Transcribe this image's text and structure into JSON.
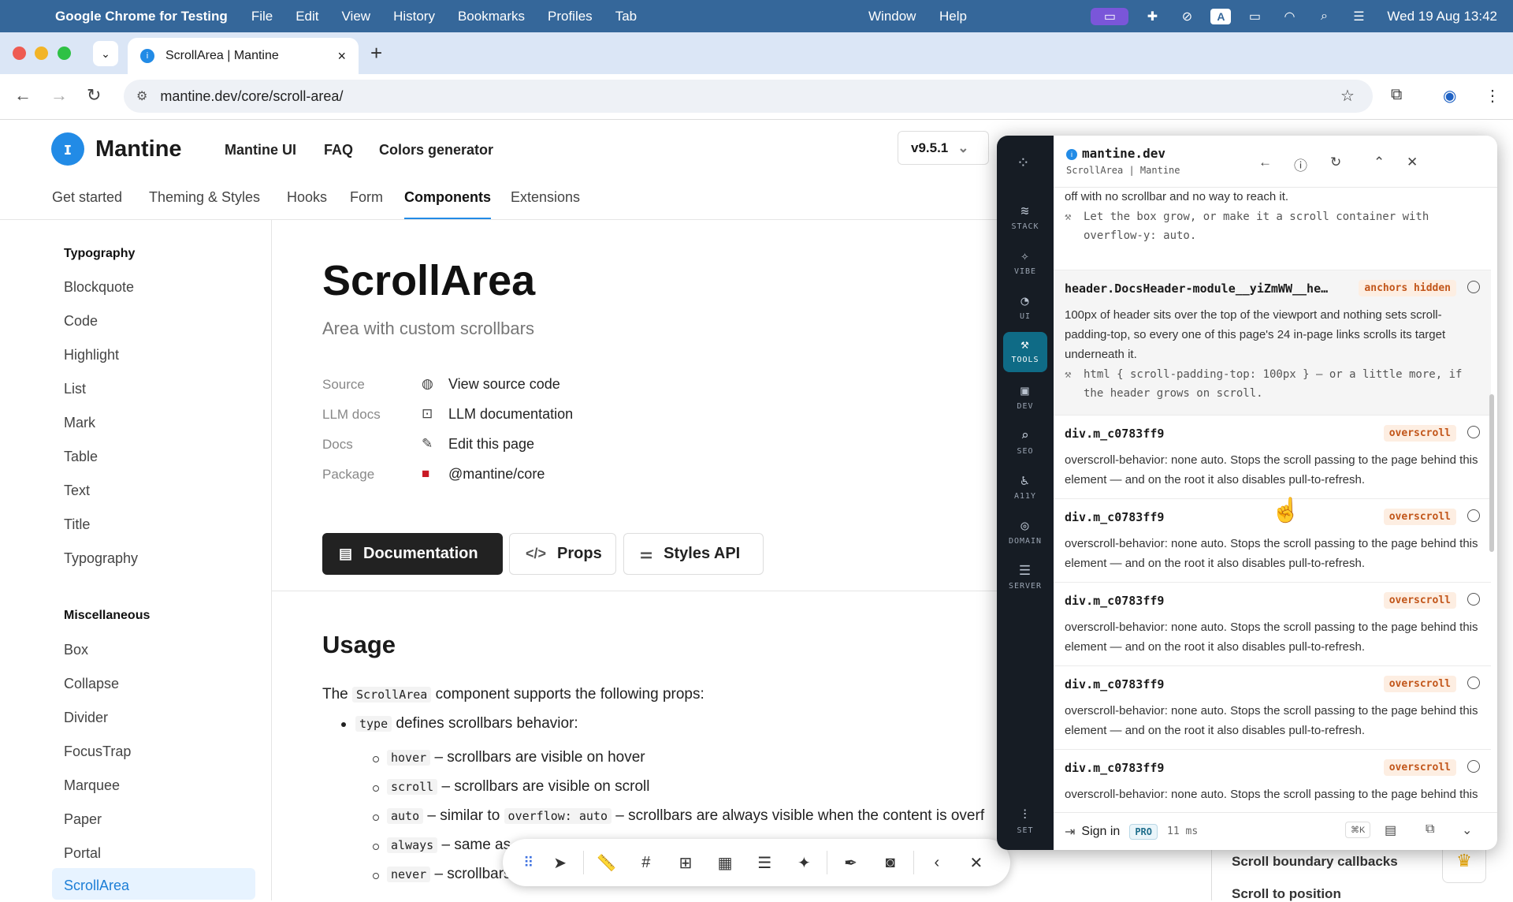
{
  "menubar": {
    "app_name": "Google Chrome for Testing",
    "items": [
      "File",
      "Edit",
      "View",
      "History",
      "Bookmarks",
      "Profiles",
      "Tab"
    ],
    "window": "Window",
    "help": "Help",
    "tray_a": "A",
    "clock": "Wed 19 Aug  13:42"
  },
  "browser": {
    "tab_title": "ScrollArea | Mantine",
    "url": "mantine.dev/core/scroll-area/"
  },
  "site": {
    "logo": "Mantine",
    "header_links": [
      "Mantine UI",
      "FAQ",
      "Colors generator"
    ],
    "version": "v9.5.1",
    "sections": [
      "Get started",
      "Theming & Styles",
      "Hooks",
      "Form",
      "Components",
      "Extensions"
    ],
    "active_section": "Components"
  },
  "sidebar": {
    "group1": "Typography",
    "group1_items": [
      "Blockquote",
      "Code",
      "Highlight",
      "List",
      "Mark",
      "Table",
      "Text",
      "Title",
      "Typography"
    ],
    "group2": "Miscellaneous",
    "group2_items": [
      "Box",
      "Collapse",
      "Divider",
      "FocusTrap",
      "Marquee",
      "Paper",
      "Portal",
      "ScrollArea"
    ],
    "selected": "ScrollArea"
  },
  "page": {
    "title": "ScrollArea",
    "subtitle": "Area with custom scrollbars",
    "meta": [
      {
        "key": "Source",
        "value": "View source code"
      },
      {
        "key": "LLM docs",
        "value": "LLM documentation"
      },
      {
        "key": "Docs",
        "value": "Edit this page"
      },
      {
        "key": "Package",
        "value": "@mantine/core"
      }
    ],
    "tabs": [
      "Documentation",
      "Props",
      "Styles API"
    ],
    "usage_heading": "Usage",
    "intro_pre": "The",
    "intro_code": "ScrollArea",
    "intro_post": "component supports the following props:",
    "type_code": "type",
    "type_text": "defines scrollbars behavior:",
    "list": [
      {
        "code": "hover",
        "text": "– scrollbars are visible on hover"
      },
      {
        "code": "scroll",
        "text": "– scrollbars are visible on scroll"
      },
      {
        "code": "auto",
        "text": "– similar to",
        "code2": "overflow: auto",
        "text2": "– scrollbars are always visible when the content is overf"
      },
      {
        "code": "always",
        "text": "– same as"
      },
      {
        "code": "never",
        "text": "– scrollbars"
      }
    ]
  },
  "toc": [
    "Scroll boundary callbacks",
    "Scroll to position"
  ],
  "panel": {
    "domain": "mantine.dev",
    "subtitle": "ScrollArea | Mantine",
    "rail": [
      "STACK",
      "VIBE",
      "UI",
      "TOOLS",
      "DEV",
      "SEO",
      "A11Y",
      "DOMAIN",
      "SERVER",
      "SET"
    ],
    "active_rail": "TOOLS",
    "top_partial_desc": "off with no scrollbar and no way to reach it.",
    "top_partial_fix": "Let the box grow, or make it a scroll container with overflow-y: auto.",
    "issues": [
      {
        "selector": "header.DocsHeader-module__yiZmWW__he…",
        "tag": "anchors hidden",
        "desc": "100px of header sits over the top of the viewport and nothing sets scroll-padding-top, so every one of this page's 24 in-page links scrolls its target underneath it.",
        "fix": "html { scroll-padding-top: 100px } — or a little more, if the header grows on scroll."
      },
      {
        "selector": "div.m_c0783ff9",
        "tag": "overscroll",
        "desc": "overscroll-behavior: none auto. Stops the scroll passing to the page behind this element — and on the root it also disables pull-to-refresh."
      },
      {
        "selector": "div.m_c0783ff9",
        "tag": "overscroll",
        "desc": "overscroll-behavior: none auto. Stops the scroll passing to the page behind this element — and on the root it also disables pull-to-refresh."
      },
      {
        "selector": "div.m_c0783ff9",
        "tag": "overscroll",
        "desc": "overscroll-behavior: none auto. Stops the scroll passing to the page behind this element — and on the root it also disables pull-to-refresh."
      },
      {
        "selector": "div.m_c0783ff9",
        "tag": "overscroll",
        "desc": "overscroll-behavior: none auto. Stops the scroll passing to the page behind this element — and on the root it also disables pull-to-refresh."
      },
      {
        "selector": "div.m_c0783ff9",
        "tag": "overscroll",
        "desc": "overscroll-behavior: none auto. Stops the scroll passing to the page behind this element — and on the root it also disables pull-to-refresh."
      }
    ],
    "footer": {
      "signin": "Sign in",
      "pro": "PRO",
      "timing": "11 ms",
      "shortcut": "⌘K"
    }
  }
}
